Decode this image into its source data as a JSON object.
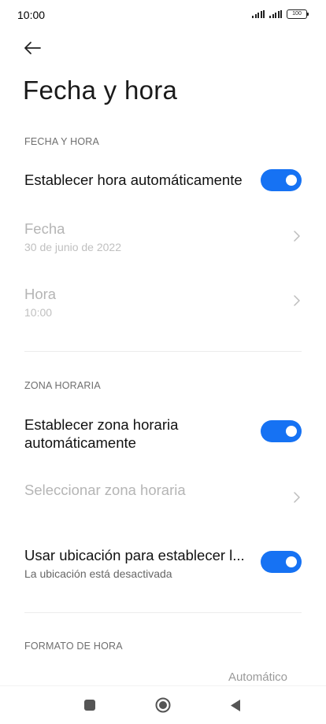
{
  "status_bar": {
    "time": "10:00",
    "battery": "100"
  },
  "page": {
    "title": "Fecha y hora"
  },
  "sections": {
    "date_time_header": "FECHA Y HORA",
    "timezone_header": "ZONA HORARIA",
    "time_format_header": "FORMATO DE HORA"
  },
  "settings": {
    "auto_time": {
      "label": "Establecer hora automáticamente",
      "enabled": true
    },
    "date": {
      "label": "Fecha",
      "value": "30 de junio de 2022"
    },
    "time": {
      "label": "Hora",
      "value": "10:00"
    },
    "auto_timezone": {
      "label_line1": "Establecer zona horaria",
      "label_line2": "automáticamente",
      "enabled": true
    },
    "select_timezone": {
      "label": "Seleccionar zona horaria"
    },
    "use_location": {
      "label": "Usar ubicación para establecer l...",
      "sub": "La ubicación está desactivada",
      "enabled": true
    },
    "time_format": {
      "value": "Automático"
    }
  },
  "colors": {
    "accent": "#1672f3",
    "disabled_text": "#b5b5b5",
    "section_header": "#6e6e6e"
  },
  "icons": {
    "back": "arrow-left-icon",
    "chevron": "chevron-right-icon"
  }
}
